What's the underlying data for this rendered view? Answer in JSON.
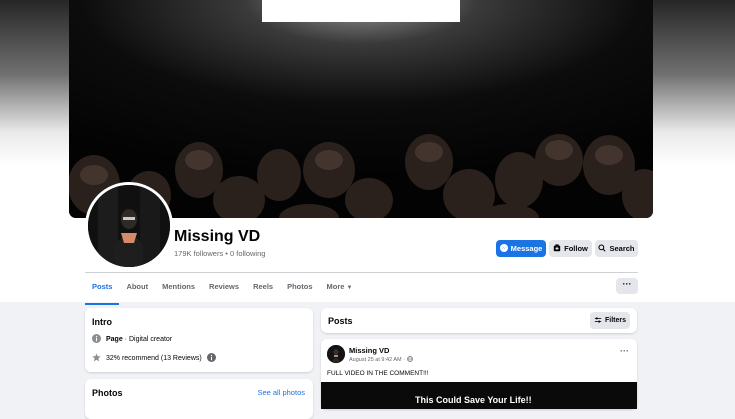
{
  "profile": {
    "name": "Missing VD",
    "followers_text": "179K followers • 0 following"
  },
  "actions": {
    "message_label": "Message",
    "follow_label": "Follow",
    "search_label": "Search"
  },
  "tabs": [
    {
      "label": "Posts",
      "active": true
    },
    {
      "label": "About"
    },
    {
      "label": "Mentions"
    },
    {
      "label": "Reviews"
    },
    {
      "label": "Reels"
    },
    {
      "label": "Photos"
    },
    {
      "label": "More"
    }
  ],
  "intro": {
    "title": "Intro",
    "page_type_bold": "Page",
    "page_type_rest": " · Digital creator",
    "recommend_text": "32% recommend (13 Reviews)"
  },
  "photos": {
    "title": "Photos",
    "see_all": "See all photos"
  },
  "posts": {
    "title": "Posts",
    "filters_label": "Filters"
  },
  "post": {
    "author": "Missing VD",
    "time": "August 25 at 9:42 AM · ",
    "text": "FULL VIDEO IN THE COMMENT!!!",
    "media_text": "This Could Save Your Life!!"
  },
  "colors": {
    "accent": "#1b74e4",
    "background": "#f0f2f5"
  }
}
